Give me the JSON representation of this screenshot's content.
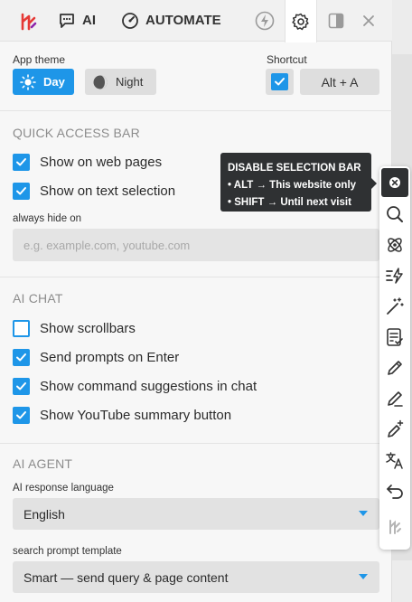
{
  "tabs": {
    "ai": "AI",
    "automate": "AUTOMATE"
  },
  "theme": {
    "label": "App theme",
    "day": "Day",
    "night": "Night"
  },
  "shortcut": {
    "label": "Shortcut",
    "key": "Alt + A"
  },
  "quick_access": {
    "title": "QUICK ACCESS BAR",
    "web_pages": "Show on web pages",
    "text_selection": "Show on text selection",
    "hide_label": "always hide on",
    "hide_placeholder": "e.g. example.com, youtube.com"
  },
  "ai_chat": {
    "title": "AI CHAT",
    "scrollbars": "Show scrollbars",
    "enter": "Send prompts on Enter",
    "commands": "Show command suggestions in chat",
    "youtube": "Show YouTube summary button"
  },
  "ai_agent": {
    "title": "AI AGENT",
    "lang_label": "AI response language",
    "lang_value": "English",
    "template_label": "search prompt template",
    "template_value": "Smart — send query & page content"
  },
  "tooltip": {
    "title": "DISABLE SELECTION BAR",
    "line1": "• ALT → This website only",
    "line2": "• SHIFT → Until next visit"
  },
  "colors": {
    "accent": "#1e96e8",
    "tooltip_bg": "#2f3133",
    "panel_bg": "#f7f7f7"
  },
  "icons": {
    "tabbar": [
      "harpa-logo-icon",
      "chat-icon",
      "gauge-icon",
      "bolt-icon",
      "gear-icon",
      "sidebar-toggle-icon",
      "close-icon"
    ],
    "selection_bar": [
      "close-icon",
      "search-icon",
      "atom-icon",
      "lightning-list-icon",
      "magic-wand-icon",
      "checklist-icon",
      "pencil-icon",
      "pencil-lines-icon",
      "pencil-sparkle-icon",
      "translate-icon",
      "undo-icon",
      "harpa-logo-icon"
    ]
  }
}
